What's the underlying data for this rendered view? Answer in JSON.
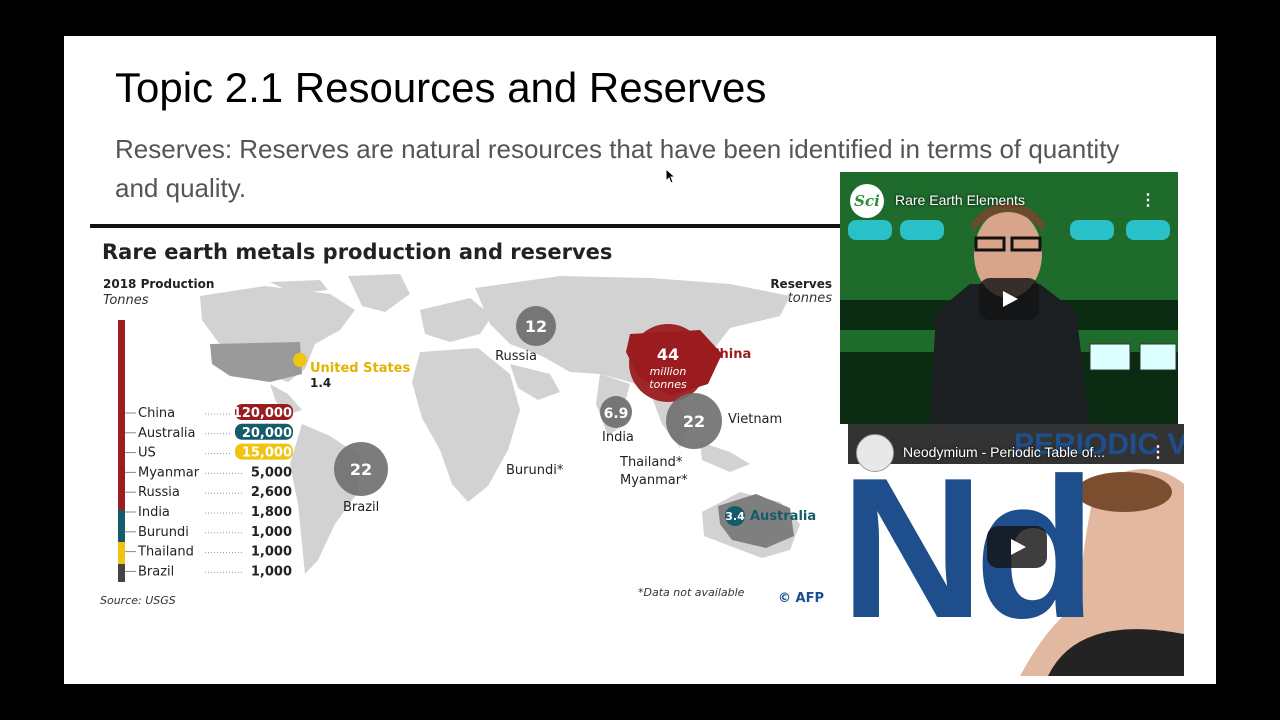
{
  "slide": {
    "title": "Topic 2.1 Resources and Reserves",
    "body": "Reserves: Reserves are natural resources that have been identified in terms of quantity and quality."
  },
  "infographic": {
    "title": "Rare earth metals production and reserves",
    "production_label": "2018 Production",
    "production_unit": "Tonnes",
    "reserves_label": "Reserves",
    "reserves_unit": "Million tonnes",
    "source": "Source: USGS",
    "note": "*Data not available",
    "credit": "© AFP",
    "production_rows": [
      {
        "country": "China",
        "value": "120,000",
        "badge_color": "#9b1c1f"
      },
      {
        "country": "Australia",
        "value": "20,000",
        "badge_color": "#165b6b"
      },
      {
        "country": "US",
        "value": "15,000",
        "badge_color": "#f1c40f"
      },
      {
        "country": "Myanmar",
        "value": "5,000"
      },
      {
        "country": "Russia",
        "value": "2,600"
      },
      {
        "country": "India",
        "value": "1,800"
      },
      {
        "country": "Burundi",
        "value": "1,000"
      },
      {
        "country": "Thailand",
        "value": "1,000"
      },
      {
        "country": "Brazil",
        "value": "1,000"
      }
    ],
    "reserves": {
      "china": {
        "name": "China",
        "value": "44",
        "unit": "million tonnes",
        "unit_line1": "million",
        "unit_line2": "tonnes"
      },
      "russia": {
        "name": "Russia",
        "value": "12"
      },
      "india": {
        "name": "India",
        "value": "6.9"
      },
      "vietnam": {
        "name": "Vietnam",
        "value": "22"
      },
      "brazil": {
        "name": "Brazil",
        "value": "22"
      },
      "usa": {
        "name": "United States",
        "value": "1.4"
      },
      "australia": {
        "name": "Australia",
        "value": "3.4"
      },
      "burundi": {
        "name": "Burundi*"
      },
      "thailand": {
        "name": "Thailand*"
      },
      "myanmar": {
        "name": "Myanmar*"
      }
    },
    "colors": {
      "china": "#9b1c1f",
      "australia": "#165b6b",
      "us": "#f1c40f",
      "bubble": "#6e6e6e",
      "land": "#d2d2d2"
    }
  },
  "videos": [
    {
      "title": "Rare Earth Elements",
      "channel_badge": "Sci"
    },
    {
      "title": "Neodymium - Periodic Table of...",
      "banner": "PERIODIC VIDE",
      "symbol": "Nd"
    }
  ]
}
